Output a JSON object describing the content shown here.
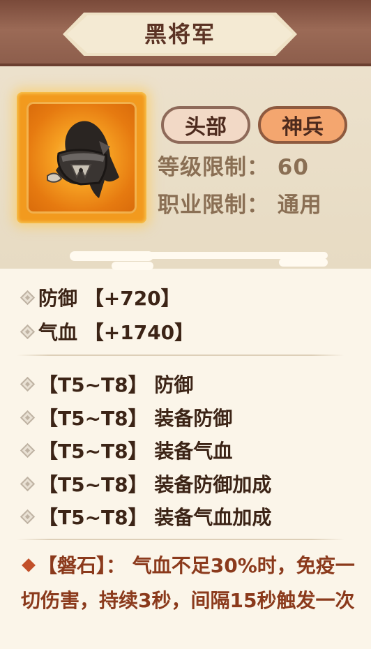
{
  "item": {
    "name": "黑将军",
    "slot": "头部",
    "grade": "神兵",
    "level_requirement": "等级限制：  60",
    "class_requirement": "职业限制：  通用",
    "icon": "black-helmet-icon"
  },
  "base_stats": [
    {
      "text": "防御 【+720】"
    },
    {
      "text": "气血 【+1740】"
    }
  ],
  "bonus_stats": [
    {
      "text": "【T5~T8】 防御"
    },
    {
      "text": "【T5~T8】 装备防御"
    },
    {
      "text": "【T5~T8】 装备气血"
    },
    {
      "text": "【T5~T8】 装备防御加成"
    },
    {
      "text": "【T5~T8】 装备气血加成"
    }
  ],
  "skill": {
    "text": "【磐石】：  气血不足30%时，免疫一切伤害，持续3秒，间隔15秒触发一次"
  },
  "colors": {
    "header": "#8c5d4b",
    "title": "#5b3324",
    "panel": "#e9ddc6",
    "grade_badge": "#f4a66f",
    "skill_text": "#8b3a1c"
  }
}
